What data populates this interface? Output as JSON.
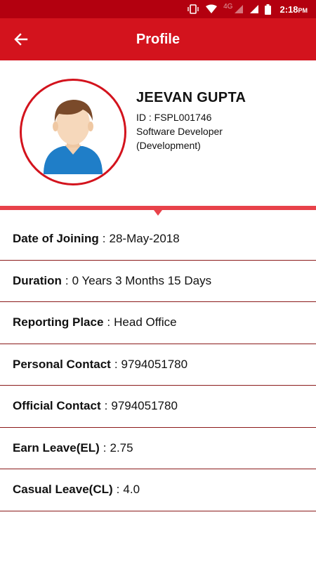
{
  "status_bar": {
    "network": "4G",
    "time": "2:18",
    "ampm": "PM"
  },
  "app_bar": {
    "title": "Profile",
    "back_icon": "arrow-left-icon"
  },
  "profile": {
    "name": "JEEVAN GUPTA",
    "id_line": "ID : FSPL001746",
    "designation": "Software Developer",
    "department": "(Development)",
    "avatar_icon": "person-avatar-icon"
  },
  "details": [
    {
      "label": "Date of Joining",
      "value": "28-May-2018"
    },
    {
      "label": "Duration",
      "value": "0 Years 3 Months 15 Days"
    },
    {
      "label": "Reporting Place",
      "value": "Head Office"
    },
    {
      "label": "Personal Contact",
      "value": "9794051780"
    },
    {
      "label": "Official Contact",
      "value": "9794051780"
    },
    {
      "label": "Earn Leave(EL)",
      "value": "2.75"
    },
    {
      "label": "Casual Leave(CL)",
      "value": "4.0"
    }
  ],
  "colors": {
    "status_bar": "#b3000f",
    "app_bar": "#d3131d",
    "accent": "#e8424a",
    "row_divider": "#8b1a1a"
  }
}
